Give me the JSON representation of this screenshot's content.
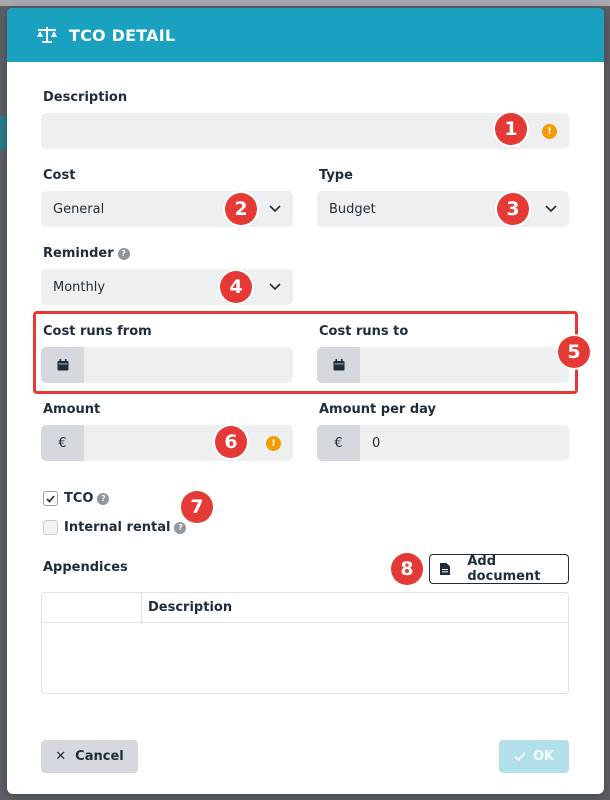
{
  "modal": {
    "title": "TCO DETAIL"
  },
  "fields": {
    "description": {
      "label": "Description",
      "value": ""
    },
    "cost": {
      "label": "Cost",
      "value": "General"
    },
    "type": {
      "label": "Type",
      "value": "Budget"
    },
    "reminder": {
      "label": "Reminder",
      "value": "Monthly"
    },
    "cost_runs_from": {
      "label": "Cost runs from",
      "value": ""
    },
    "cost_runs_to": {
      "label": "Cost runs to",
      "value": ""
    },
    "amount": {
      "label": "Amount",
      "currency": "€",
      "value": ""
    },
    "amount_per_day": {
      "label": "Amount per day",
      "currency": "€",
      "value": "0"
    }
  },
  "checkboxes": {
    "tco": {
      "label": "TCO",
      "checked": true
    },
    "internal_rental": {
      "label": "Internal rental",
      "checked": false
    }
  },
  "appendices": {
    "label": "Appendices",
    "add_button": "Add document",
    "columns": [
      "",
      "Description"
    ],
    "rows": []
  },
  "footer": {
    "cancel": "Cancel",
    "ok": "OK"
  },
  "markers": [
    "1",
    "2",
    "3",
    "4",
    "5",
    "6",
    "7",
    "8"
  ],
  "colors": {
    "header": "#1aa1bf",
    "marker": "#e53935",
    "warning": "#f59b00",
    "ok_disabled": "#b2e0ea"
  }
}
